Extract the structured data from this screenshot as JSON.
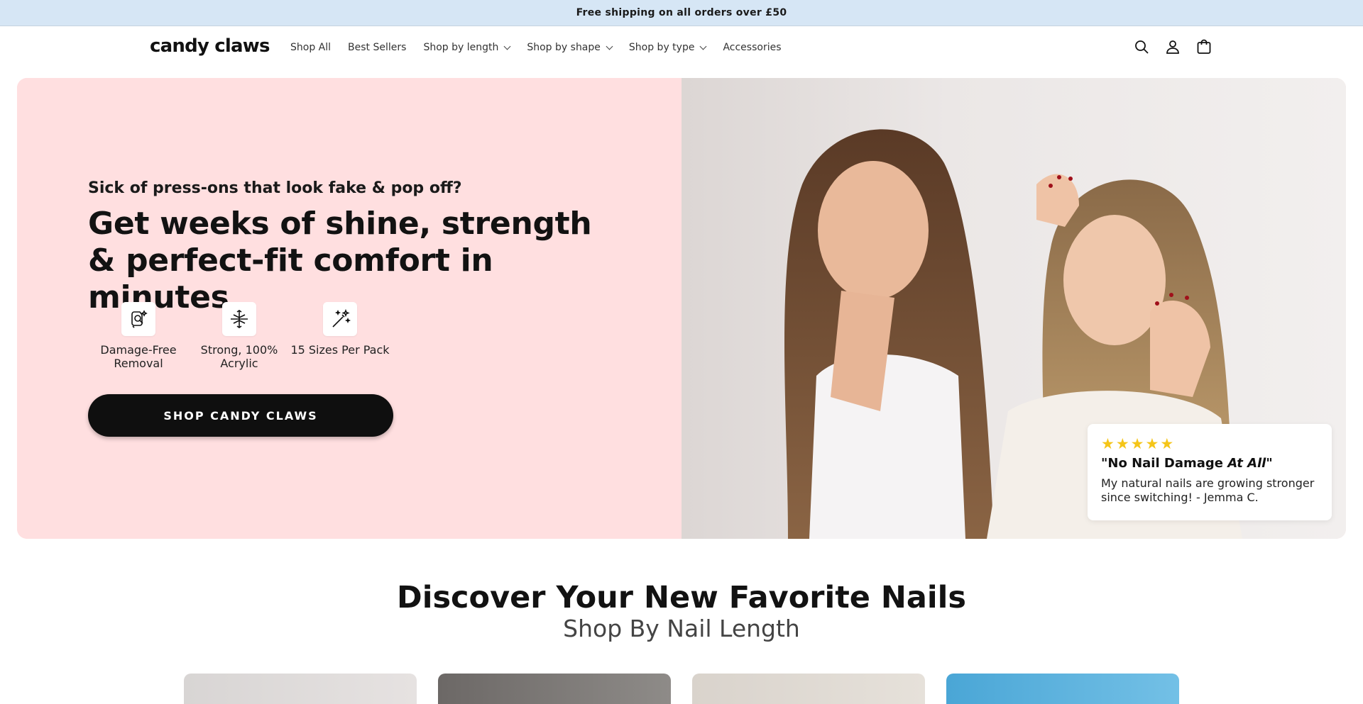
{
  "announcement": {
    "text": "Free shipping on all orders over £50"
  },
  "header": {
    "logo": "candy claws",
    "nav": [
      {
        "label": "Shop All",
        "has_dropdown": false
      },
      {
        "label": "Best Sellers",
        "has_dropdown": false
      },
      {
        "label": "Shop by length",
        "has_dropdown": true
      },
      {
        "label": "Shop by shape",
        "has_dropdown": true
      },
      {
        "label": "Shop by type",
        "has_dropdown": true
      },
      {
        "label": "Accessories",
        "has_dropdown": false
      }
    ],
    "icons": [
      "search-icon",
      "account-icon",
      "cart-icon"
    ]
  },
  "hero": {
    "subheading": "Sick of press-ons that look fake & pop off?",
    "title": "Get weeks of shine, strength & perfect-fit comfort in minutes",
    "features": [
      {
        "icon": "nail-removal-icon",
        "label": "Damage-Free Removal"
      },
      {
        "icon": "strength-icon",
        "label": "Strong, 100% Acrylic"
      },
      {
        "icon": "magic-wand-icon",
        "label": "15 Sizes Per Pack"
      }
    ],
    "cta_label": "SHOP CANDY CLAWS",
    "review": {
      "stars": 5,
      "title_prefix": "\"No Nail Damage ",
      "title_emphasis": "At All",
      "title_suffix": "\"",
      "text": "My natural nails are growing stronger since switching! - Jemma C."
    },
    "colors": {
      "left_bg": "#ffdfe0",
      "cta_bg": "#0f0f0f",
      "star": "#f5c518"
    }
  },
  "collection": {
    "title": "Discover Your New Favorite Nails",
    "subtitle": "Shop By Nail Length"
  }
}
